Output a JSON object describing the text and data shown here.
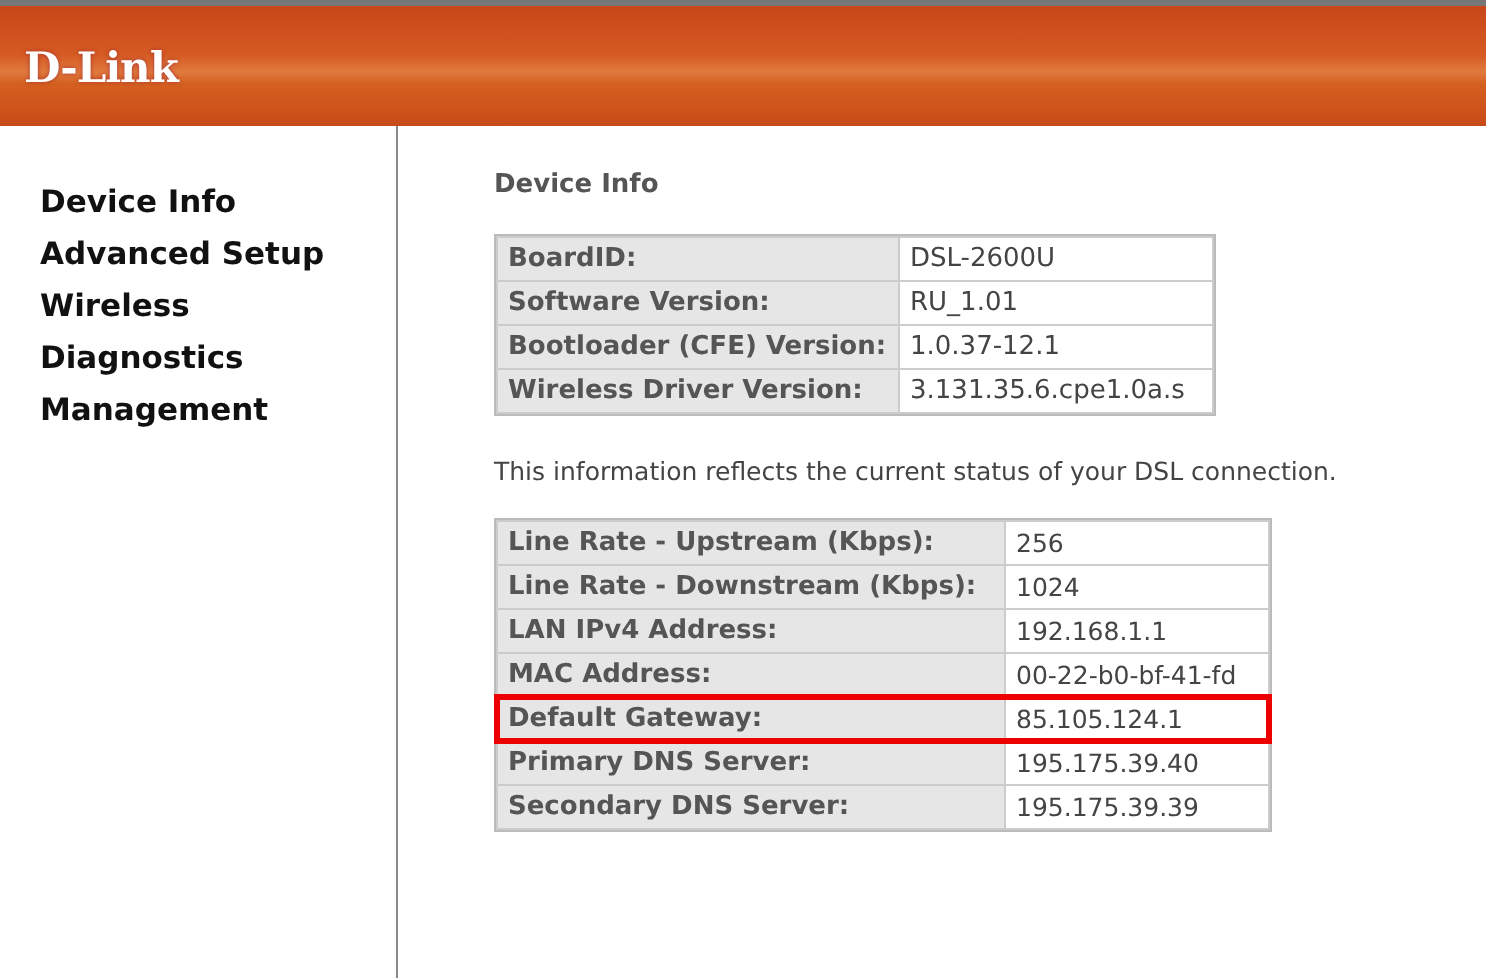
{
  "header": {
    "logo": "D-Link"
  },
  "sidebar": {
    "items": [
      {
        "label": "Device Info"
      },
      {
        "label": "Advanced Setup"
      },
      {
        "label": "Wireless"
      },
      {
        "label": "Diagnostics"
      },
      {
        "label": "Management"
      }
    ]
  },
  "main": {
    "title": "Device Info",
    "device_table": [
      {
        "label": "BoardID:",
        "value": "DSL-2600U"
      },
      {
        "label": "Software Version:",
        "value": "RU_1.01"
      },
      {
        "label": "Bootloader (CFE) Version:",
        "value": "1.0.37-12.1"
      },
      {
        "label": "Wireless Driver Version:",
        "value": "3.131.35.6.cpe1.0a.s"
      }
    ],
    "note": "This information reflects the current status of your DSL connection.",
    "status_table": [
      {
        "label": "Line Rate - Upstream (Kbps):",
        "value": "256",
        "highlighted": false
      },
      {
        "label": "Line Rate - Downstream (Kbps):",
        "value": "1024",
        "highlighted": false
      },
      {
        "label": "LAN IPv4 Address:",
        "value": "192.168.1.1",
        "highlighted": false
      },
      {
        "label": "MAC Address:",
        "value": "00-22-b0-bf-41-fd",
        "highlighted": false
      },
      {
        "label": "Default Gateway:",
        "value": "85.105.124.1",
        "highlighted": true
      },
      {
        "label": "Primary DNS Server:",
        "value": "195.175.39.40",
        "highlighted": false
      },
      {
        "label": "Secondary DNS Server:",
        "value": "195.175.39.39",
        "highlighted": false
      }
    ]
  }
}
